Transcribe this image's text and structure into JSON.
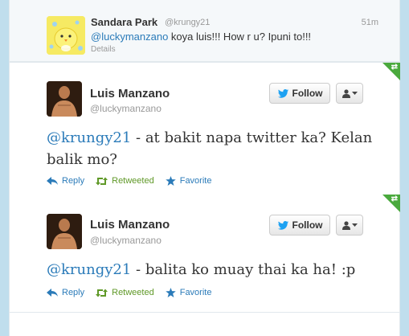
{
  "context_tweet": {
    "name": "Sandara Park",
    "handle": "@krungy21",
    "time": "51m",
    "mention": "@luckymanzano",
    "text": " koya luis!!! How r u? Ipuni to!!!",
    "details": "Details"
  },
  "tweets": [
    {
      "name": "Luis Manzano",
      "handle": "@luckymanzano",
      "follow_label": "Follow",
      "mention": "@krungy21",
      "text": " - at bakit napa twitter ka? Kelan balik mo?",
      "actions": {
        "reply": "Reply",
        "retweeted": "Retweeted",
        "favorite": "Favorite"
      }
    },
    {
      "name": "Luis Manzano",
      "handle": "@luckymanzano",
      "follow_label": "Follow",
      "mention": "@krungy21",
      "text": " - balita ko muay thai ka ha! :p",
      "actions": {
        "reply": "Reply",
        "retweeted": "Retweeted",
        "favorite": "Favorite"
      }
    }
  ],
  "colors": {
    "link": "#2b7bb9",
    "retweeted": "#609928",
    "corner": "#4aa93d",
    "bird": "#1da1f2"
  }
}
